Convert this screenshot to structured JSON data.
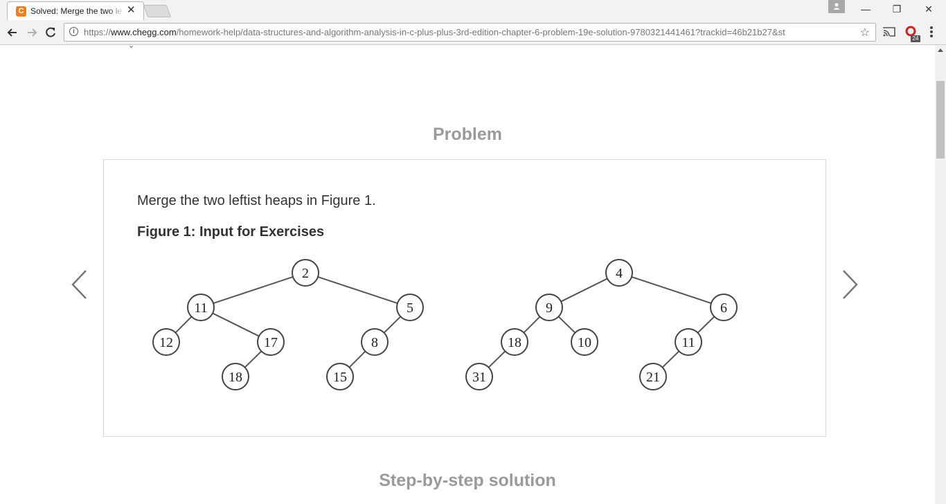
{
  "browser": {
    "tab_favicon": "C",
    "tab_title": "Solved: Merge the two le",
    "tab_close": "✕",
    "url_scheme": "https://",
    "url_host": "www.chegg.com",
    "url_path": "/homework-help/data-structures-and-algorithm-analysis-in-c-plus-plus-3rd-edition-chapter-6-problem-19e-solution-9780321441461?trackid=46b21b27&st",
    "extension_badge": "24",
    "window_minimize": "—",
    "window_restore": "❐",
    "window_close": "✕"
  },
  "page": {
    "problem_heading": "Problem",
    "problem_text": "Merge the two leftist heaps in Figure 1.",
    "figure_caption": "Figure 1: Input for Exercises",
    "solution_heading": "Step-by-step solution"
  },
  "heaps": [
    {
      "nodes": [
        "2",
        "11",
        "5",
        "12",
        "17",
        "8",
        "18",
        "15"
      ],
      "edges": [
        [
          "2",
          "11"
        ],
        [
          "2",
          "5"
        ],
        [
          "11",
          "12"
        ],
        [
          "11",
          "17"
        ],
        [
          "17",
          "18"
        ],
        [
          "5",
          "8"
        ],
        [
          "8",
          "15"
        ]
      ]
    },
    {
      "nodes": [
        "4",
        "9",
        "6",
        "18",
        "10",
        "11",
        "31",
        "21"
      ],
      "edges": [
        [
          "4",
          "9"
        ],
        [
          "4",
          "6"
        ],
        [
          "9",
          "18"
        ],
        [
          "9",
          "10"
        ],
        [
          "18",
          "31"
        ],
        [
          "6",
          "11"
        ],
        [
          "11",
          "21"
        ]
      ]
    }
  ],
  "colors": {
    "heading_gray": "#9a9a9a",
    "favicon_orange": "#f07f1c"
  }
}
